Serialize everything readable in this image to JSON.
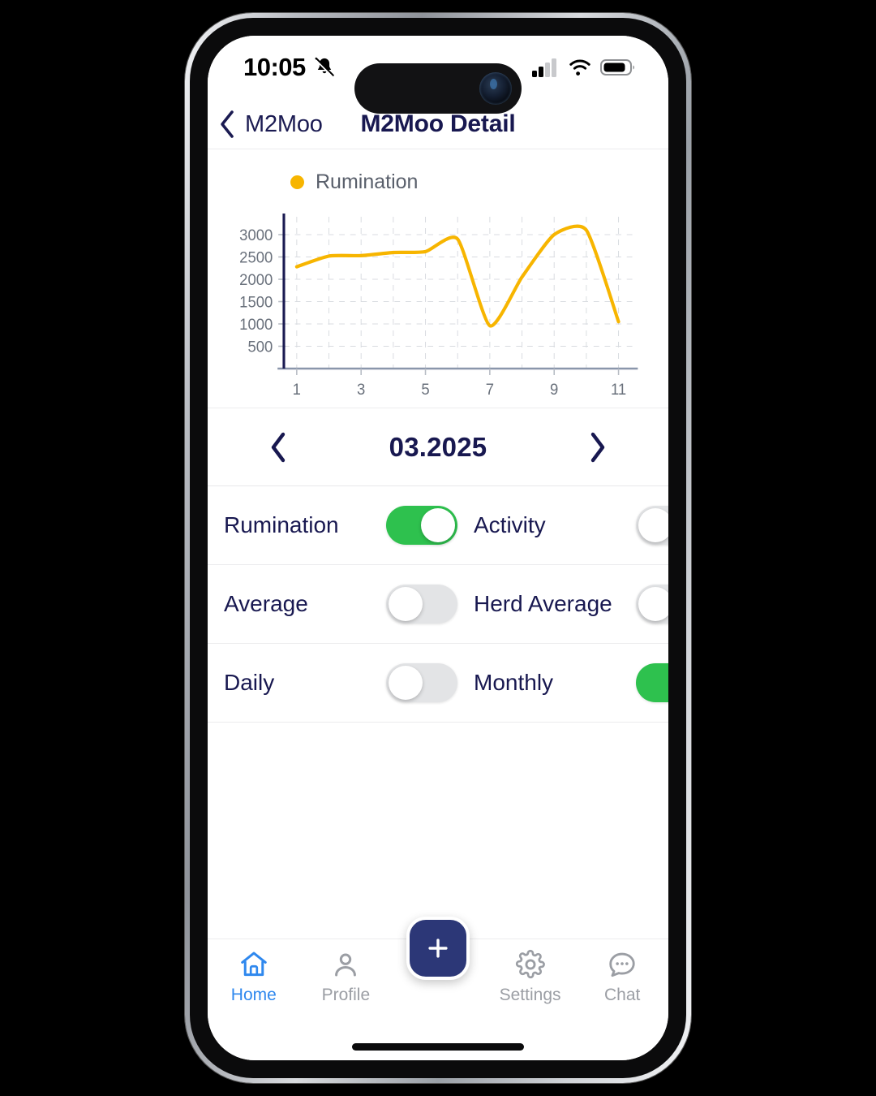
{
  "status_bar": {
    "time": "10:05",
    "silent_icon": "bell-slash-icon",
    "signal_icon": "cellular-signal-icon",
    "wifi_icon": "wifi-icon",
    "battery_icon": "battery-icon",
    "battery_level_pct": 75
  },
  "nav": {
    "back_label": "M2Moo",
    "back_icon": "chevron-left-icon",
    "title": "M2Moo Detail"
  },
  "chart_card": {
    "legend_label": "Rumination",
    "legend_color": "#f7b500"
  },
  "chart_data": {
    "type": "line",
    "title": "",
    "subtitle": "",
    "xlabel": "",
    "ylabel": "",
    "series": [
      {
        "name": "Rumination",
        "color": "#f7b500",
        "x": [
          1,
          2,
          3,
          4,
          5,
          6,
          7,
          8,
          9,
          10,
          11
        ],
        "values": [
          2280,
          2520,
          2530,
          2600,
          2620,
          2900,
          960,
          2050,
          3000,
          3100,
          1050
        ]
      }
    ],
    "x_ticks": [
      1,
      3,
      5,
      7,
      9,
      11
    ],
    "x_tick_labels": [
      "1",
      "3",
      "5",
      "7",
      "9",
      "11"
    ],
    "y_ticks": [
      500,
      1000,
      1500,
      2000,
      2500,
      3000
    ],
    "y_tick_labels": [
      "3000",
      "2500",
      "2000",
      "1500",
      "1000",
      "500"
    ],
    "xlim": [
      0.6,
      11.6
    ],
    "ylim": [
      0,
      3400
    ],
    "grid": true,
    "grid_style": "dashed",
    "grid_color": "#d8dbe0",
    "legend_position": "top-left",
    "axis_color": "#1b1b52",
    "x_axis_color": "#8a96ab",
    "smoothing": "spline"
  },
  "date_nav": {
    "prev_icon": "chevron-left-icon",
    "label": "03.2025",
    "next_icon": "chevron-right-icon"
  },
  "toggles": {
    "on_color": "#2ec14e",
    "off_color": "#e3e4e6",
    "rows": [
      [
        {
          "label": "Rumination",
          "state": "on"
        },
        {
          "label": "Activity",
          "state": "off"
        }
      ],
      [
        {
          "label": "Average",
          "state": "off"
        },
        {
          "label": "Herd Average",
          "state": "off"
        }
      ],
      [
        {
          "label": "Daily",
          "state": "off"
        },
        {
          "label": "Monthly",
          "state": "on"
        }
      ]
    ]
  },
  "tab_bar": {
    "active_color": "#2f88ee",
    "inactive_color": "#9b9ea4",
    "fab_color": "#2c3777",
    "fab_icon": "plus-icon",
    "items": [
      {
        "label": "Home",
        "icon": "home-icon",
        "active": true
      },
      {
        "label": "Profile",
        "icon": "person-icon",
        "active": false
      },
      {
        "label": "Settings",
        "icon": "gear-icon",
        "active": false
      },
      {
        "label": "Chat",
        "icon": "chat-bubble-icon",
        "active": false
      }
    ]
  }
}
